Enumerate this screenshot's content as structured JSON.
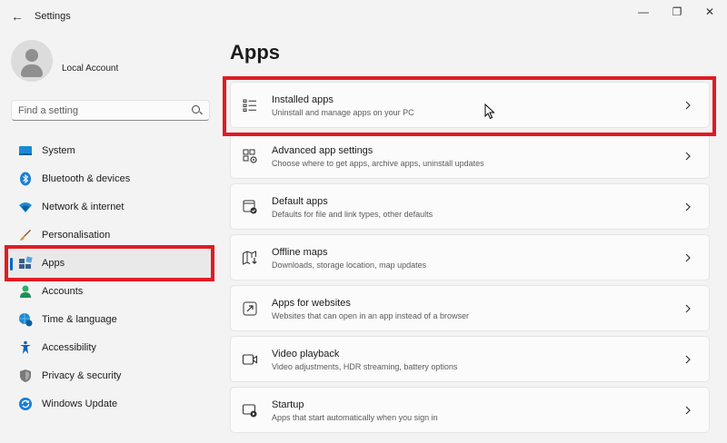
{
  "window": {
    "title": "Settings",
    "back_glyph": "←",
    "minimize_glyph": "—",
    "maximize_glyph": "❐",
    "close_glyph": "✕"
  },
  "profile": {
    "name": "Local Account"
  },
  "search": {
    "placeholder": "Find a setting"
  },
  "nav": {
    "items": [
      {
        "label": "System",
        "icon": "monitor-icon",
        "selected": false
      },
      {
        "label": "Bluetooth & devices",
        "icon": "bluetooth-icon",
        "selected": false
      },
      {
        "label": "Network & internet",
        "icon": "wifi-icon",
        "selected": false
      },
      {
        "label": "Personalisation",
        "icon": "brush-icon",
        "selected": false
      },
      {
        "label": "Apps",
        "icon": "apps-icon",
        "selected": true
      },
      {
        "label": "Accounts",
        "icon": "person-icon",
        "selected": false
      },
      {
        "label": "Time & language",
        "icon": "globe-clock-icon",
        "selected": false
      },
      {
        "label": "Accessibility",
        "icon": "accessibility-icon",
        "selected": false
      },
      {
        "label": "Privacy & security",
        "icon": "shield-icon",
        "selected": false
      },
      {
        "label": "Windows Update",
        "icon": "update-icon",
        "selected": false
      }
    ]
  },
  "main": {
    "title": "Apps",
    "cards": [
      {
        "title": "Installed apps",
        "subtitle": "Uninstall and manage apps on your PC",
        "icon": "list-icon"
      },
      {
        "title": "Advanced app settings",
        "subtitle": "Choose where to get apps, archive apps, uninstall updates",
        "icon": "app-settings-icon"
      },
      {
        "title": "Default apps",
        "subtitle": "Defaults for file and link types, other defaults",
        "icon": "default-apps-icon"
      },
      {
        "title": "Offline maps",
        "subtitle": "Downloads, storage location, map updates",
        "icon": "map-icon"
      },
      {
        "title": "Apps for websites",
        "subtitle": "Websites that can open in an app instead of a browser",
        "icon": "open-link-icon"
      },
      {
        "title": "Video playback",
        "subtitle": "Video adjustments, HDR streaming, battery options",
        "icon": "video-icon"
      },
      {
        "title": "Startup",
        "subtitle": "Apps that start automatically when you sign in",
        "icon": "startup-icon"
      }
    ]
  },
  "colors": {
    "accent": "#0067c0",
    "highlight": "#e01b24",
    "background": "#f3f3f3",
    "card": "#fbfbfb"
  }
}
